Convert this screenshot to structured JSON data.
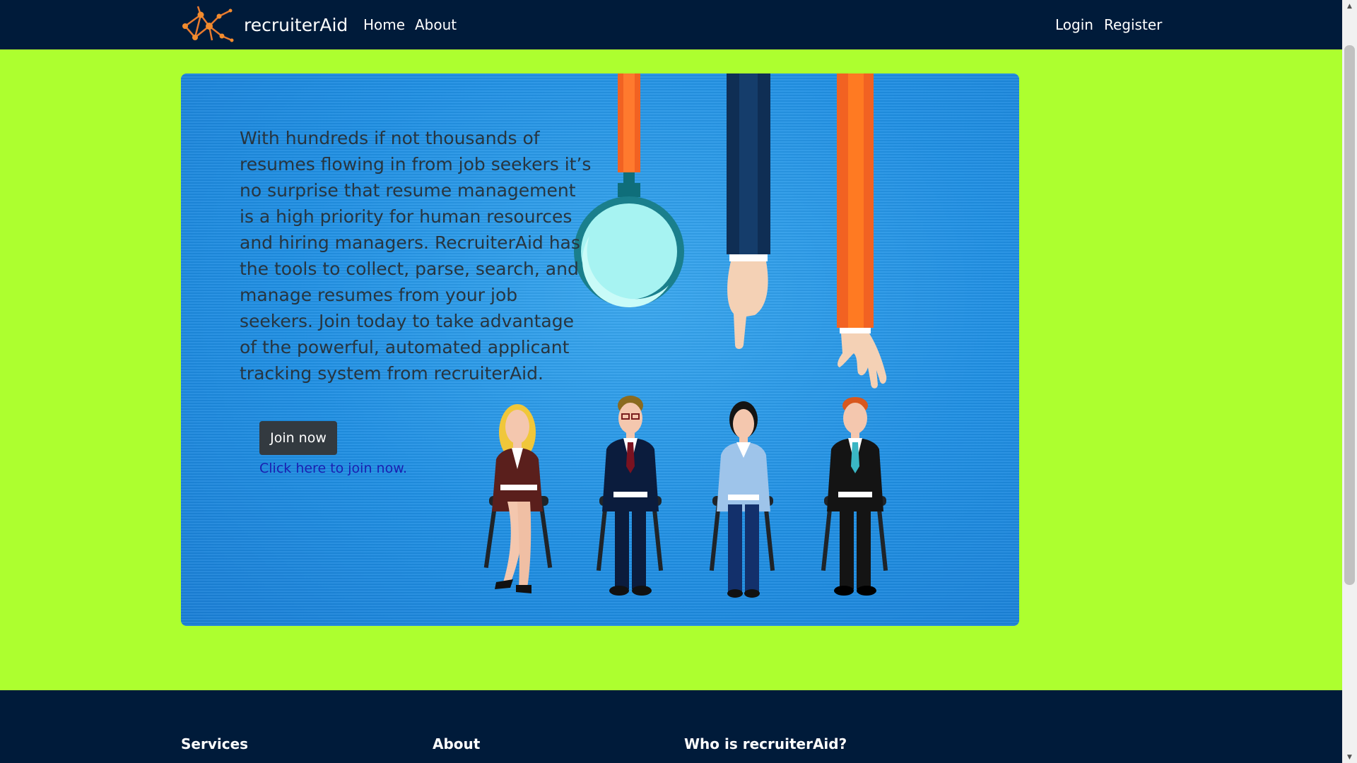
{
  "navbar": {
    "brand_name": "recruiterAid",
    "links": [
      "Home",
      "About"
    ],
    "auth": {
      "login": "Login",
      "register": "Register"
    }
  },
  "hero": {
    "description": "With hundreds if not thousands of resumes flowing in from job seekers it’s no surprise that resume management is a high priority for human resources and hiring managers. RecruiterAid has the tools to collect, parse, search, and manage resumes from your job seekers. Join today to take advantage of the powerful, automated applicant tracking system from recruiterAid.",
    "join_button": "Join now",
    "join_link": "Click here to join now."
  },
  "footer": {
    "headings": [
      "Services",
      "About",
      "Who is recruiterAid?"
    ]
  },
  "colors": {
    "page_background": "#adff2f",
    "navbar_background": "#001b3a",
    "hero_background": "#1f8fe3",
    "button_background": "#333a40",
    "link_color": "#1b1fb0"
  },
  "icons": [
    "network-logo-icon",
    "magnifying-glass-icon",
    "scroll-up-arrow-icon",
    "scroll-down-arrow-icon"
  ]
}
